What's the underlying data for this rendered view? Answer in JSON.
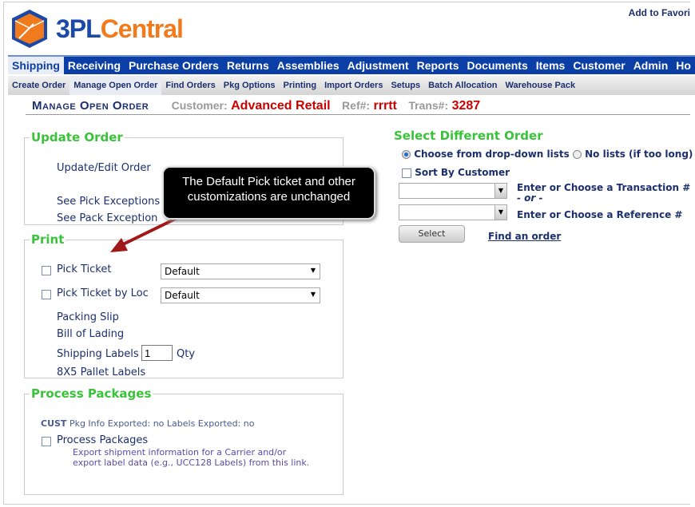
{
  "header": {
    "logo_text_a": "3PL",
    "logo_text_b": "Central",
    "add_favorites": "Add to Favori"
  },
  "nav": {
    "items": [
      "Shipping",
      "Receiving",
      "Purchase Orders",
      "Returns",
      "Assemblies",
      "Adjustment",
      "Reports",
      "Documents",
      "Items",
      "Customer",
      "Admin",
      "Ho"
    ],
    "active": "Shipping"
  },
  "subnav": {
    "items": [
      "Create Order",
      "Manage Open Order",
      "Find Orders",
      "Pkg Options",
      "Printing",
      "Import Orders",
      "Setups",
      "Batch Allocation",
      "Warehouse Pack"
    ],
    "active": "Manage Open Order"
  },
  "page": {
    "title": "Manage Open Order",
    "customer_label": "Customer:",
    "customer": "Advanced Retail",
    "ref_label": "Ref#:",
    "ref": "rrrtt",
    "trans_label": "Trans#:",
    "trans": "3287"
  },
  "update_order": {
    "legend": "Update Order",
    "links": [
      "Update/Edit Order",
      "See Pick Exceptions",
      "See Pack Exception"
    ]
  },
  "print": {
    "legend": "Print",
    "pick_ticket": "Pick Ticket",
    "pick_ticket_value": "Default",
    "pick_ticket_loc": "Pick Ticket by Loc",
    "pick_ticket_loc_value": "Default",
    "packing_slip": "Packing Slip",
    "bill_of_lading": "Bill of Lading",
    "shipping_labels": "Shipping Labels",
    "shipping_qty": "1",
    "qty_label": "Qty",
    "pallet_labels": "8X5 Pallet Labels"
  },
  "process": {
    "legend": "Process Packages",
    "cust": "CUST",
    "status": "Pkg Info Exported: no Labels Exported: no",
    "checkbox": "Process Packages",
    "desc": "Export shipment information for a Carrier and/or export label data (e.g., UCC128 Labels) from this link."
  },
  "select_order": {
    "title": "Select Different Order",
    "radio1": "Choose from drop-down lists",
    "radio2": "No lists (if too long)",
    "sort": "Sort By Customer",
    "trans_label": "Enter or Choose a Transaction #",
    "or": "- or -",
    "ref_label": "Enter or Choose a Reference #",
    "select_button": "Select",
    "find_link": "Find an order"
  },
  "callout": {
    "text": "The Default Pick ticket and other customizations are unchanged"
  },
  "colors": {
    "nav": "#0b3fa6",
    "legend": "#3ac33a",
    "red": "#cc0000",
    "navy": "#1c2f6e"
  }
}
